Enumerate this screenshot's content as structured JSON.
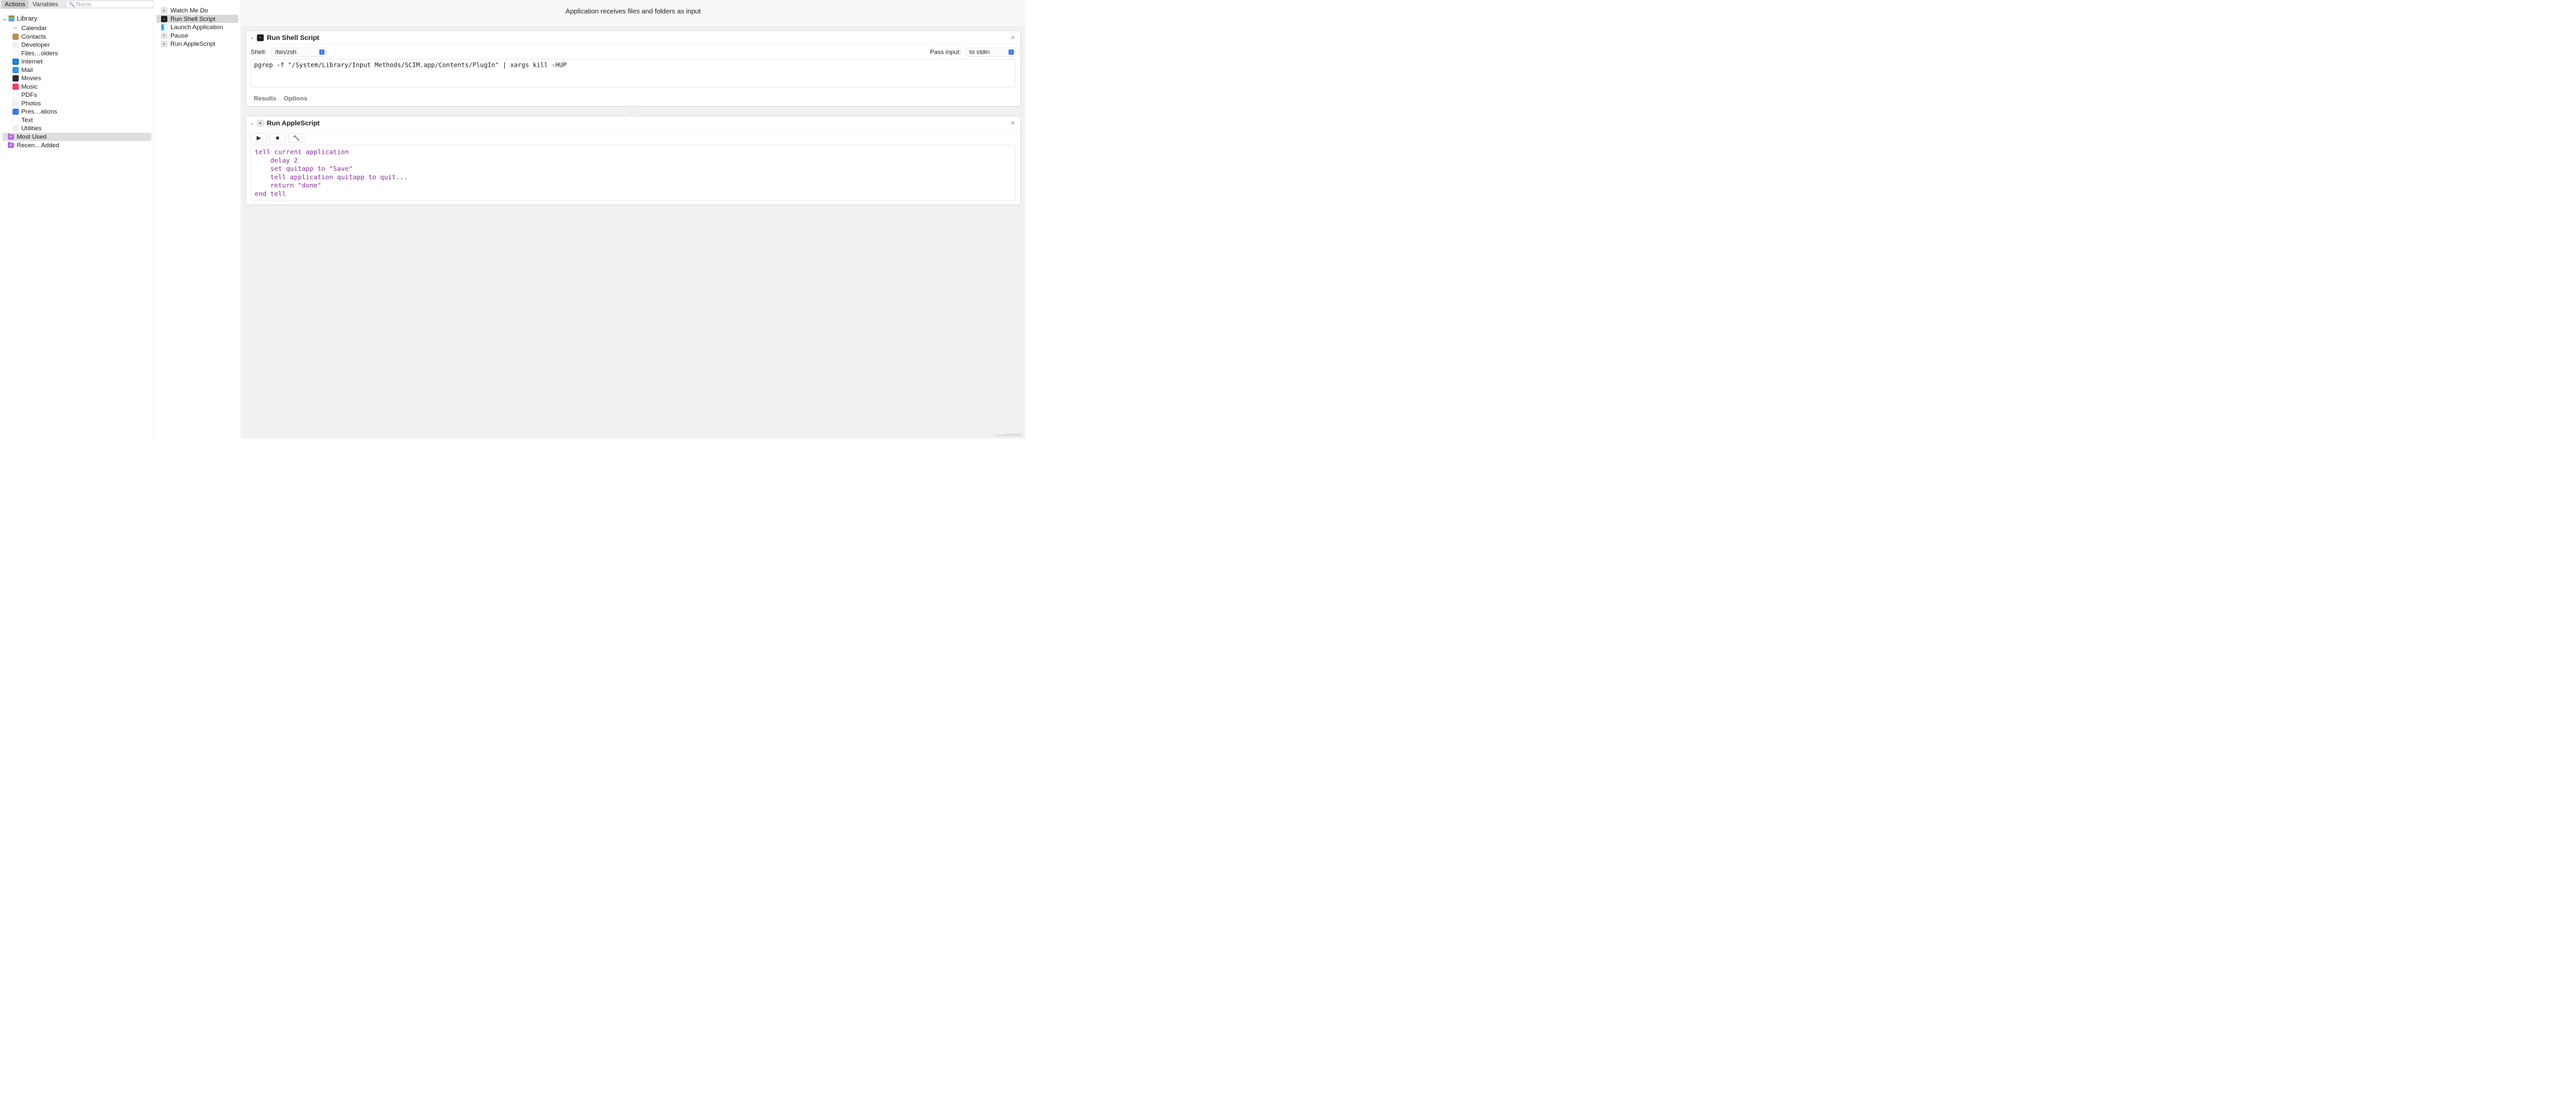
{
  "toolbar": {
    "tabs": {
      "actions": "Actions",
      "variables": "Variables"
    },
    "search_placeholder": "Name"
  },
  "sidebar": {
    "library_label": "Library",
    "items": [
      {
        "label": "Calendar",
        "icon": "ic-cal"
      },
      {
        "label": "Contacts",
        "icon": "ic-contacts"
      },
      {
        "label": "Developer",
        "icon": "ic-dev"
      },
      {
        "label": "Files…olders",
        "icon": "ic-files"
      },
      {
        "label": "Internet",
        "icon": "ic-internet"
      },
      {
        "label": "Mail",
        "icon": "ic-mail"
      },
      {
        "label": "Movies",
        "icon": "ic-movies"
      },
      {
        "label": "Music",
        "icon": "ic-music"
      },
      {
        "label": "PDFs",
        "icon": "ic-pdf"
      },
      {
        "label": "Photos",
        "icon": "ic-photos"
      },
      {
        "label": "Pres…ations",
        "icon": "ic-pres"
      },
      {
        "label": "Text",
        "icon": "ic-text"
      },
      {
        "label": "Utilities",
        "icon": "ic-util"
      }
    ],
    "smart": [
      {
        "label": "Most Used",
        "selected": true
      },
      {
        "label": "Recen…Added",
        "selected": false
      }
    ]
  },
  "actions": {
    "items": [
      {
        "label": "Watch Me Do",
        "icon": "aicon-automator",
        "selected": false
      },
      {
        "label": "Run Shell Script",
        "icon": "aicon-terminal",
        "selected": true
      },
      {
        "label": "Launch Application",
        "icon": "aicon-finder",
        "selected": false
      },
      {
        "label": "Pause",
        "icon": "aicon-automator",
        "selected": false
      },
      {
        "label": "Run AppleScript",
        "icon": "aicon-automator",
        "selected": false
      }
    ]
  },
  "workflow": {
    "header_msg": "Application receives files and folders as input",
    "step1": {
      "title": "Run Shell Script",
      "shell_label": "Shell:",
      "shell_value": "/bin/zsh",
      "pass_label": "Pass input:",
      "pass_value": "to stdin",
      "script": "pgrep -f \"/System/Library/Input Methods/SCIM.app/Contents/PlugIn\" | xargs kill -HUP",
      "results_label": "Results",
      "options_label": "Options"
    },
    "step2": {
      "title": "Run AppleScript",
      "script_lines": [
        "tell current application",
        "    delay 2",
        "    set quitapp to \"Save\"",
        "    tell application quitapp to quit...",
        "    return \"done\"",
        "end tell"
      ]
    }
  },
  "watermark": "CSDN @故苹的故障"
}
